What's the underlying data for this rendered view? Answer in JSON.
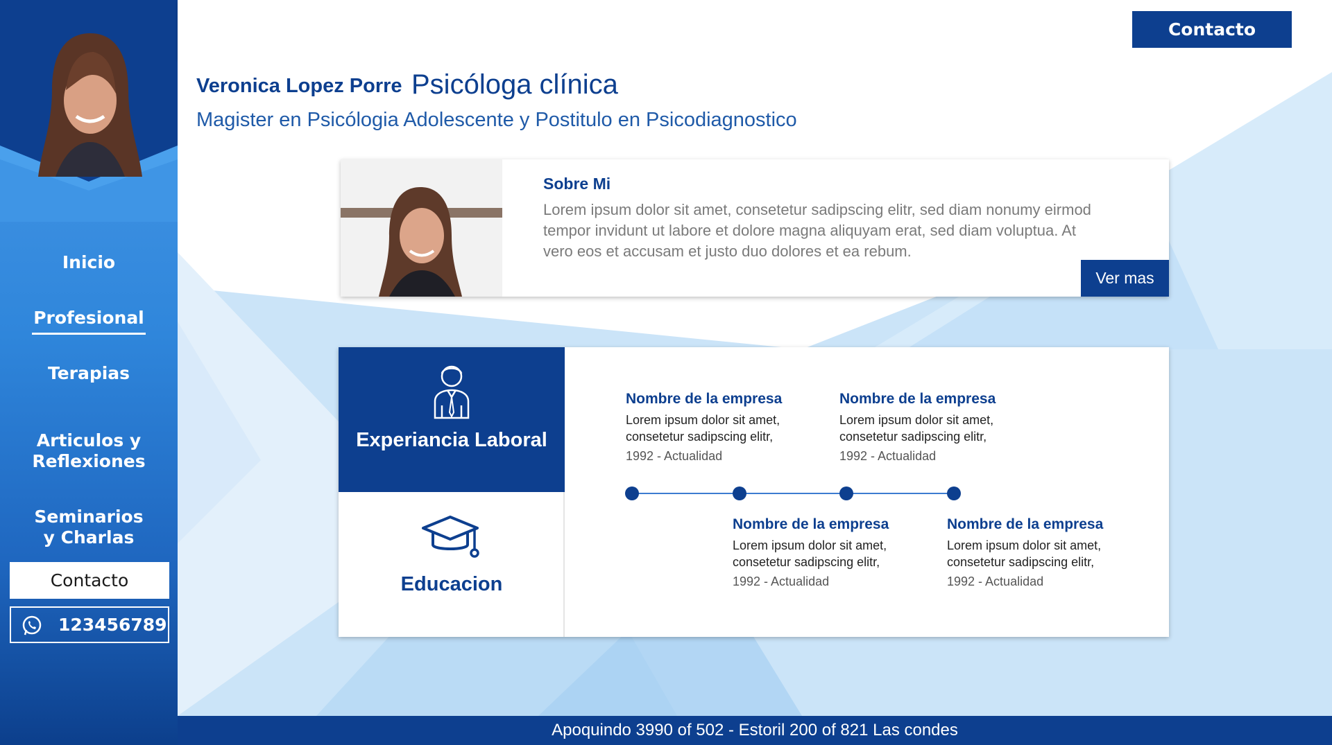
{
  "sidebar": {
    "nav": [
      {
        "label": "Inicio"
      },
      {
        "label": "Profesional"
      },
      {
        "label": "Terapias"
      },
      {
        "label": "Articulos y\nReflexiones"
      },
      {
        "label": "Seminarios\ny Charlas"
      }
    ],
    "contact_label": "Contacto",
    "phone": "123456789"
  },
  "header": {
    "contact_label": "Contacto",
    "icons": [
      "facebook-icon",
      "instagram-icon"
    ]
  },
  "profile": {
    "name": "Veronica Lopez Porre",
    "role": "Psicóloga clínica",
    "subtitle": "Magister en Psicólogia Adolescente y Postitulo en Psicodiagnostico"
  },
  "about": {
    "title": "Sobre Mi",
    "text": "Lorem ipsum dolor sit amet, consetetur sadipscing elitr, sed diam nonumy eirmod tempor invidunt ut labore et dolore magna aliquyam erat, sed diam voluptua. At vero eos et accusam et justo duo dolores et ea rebum.",
    "more_label": "Ver mas"
  },
  "experience": {
    "tab_work": "Experiancia Laboral",
    "tab_education": "Educacion",
    "entries": [
      {
        "company": "Nombre de la empresa",
        "line1": "Lorem ipsum dolor sit amet,",
        "line2": "consetetur sadipscing elitr,",
        "date": "1992 - Actualidad"
      },
      {
        "company": "Nombre de la empresa",
        "line1": "Lorem ipsum dolor sit amet,",
        "line2": "consetetur sadipscing elitr,",
        "date": "1992 - Actualidad"
      },
      {
        "company": "Nombre de la empresa",
        "line1": "Lorem ipsum dolor sit amet,",
        "line2": "consetetur sadipscing elitr,",
        "date": "1992 - Actualidad"
      },
      {
        "company": "Nombre de la empresa",
        "line1": "Lorem ipsum dolor sit amet,",
        "line2": "consetetur sadipscing elitr,",
        "date": "1992 - Actualidad"
      }
    ]
  },
  "footer": {
    "address": "Apoquindo 3990 of 502 - Estoril 200 of 821  Las condes"
  },
  "colors": {
    "brand": "#0d3f8f",
    "accent": "#3a8ee0",
    "background": "#c6e1f7"
  }
}
